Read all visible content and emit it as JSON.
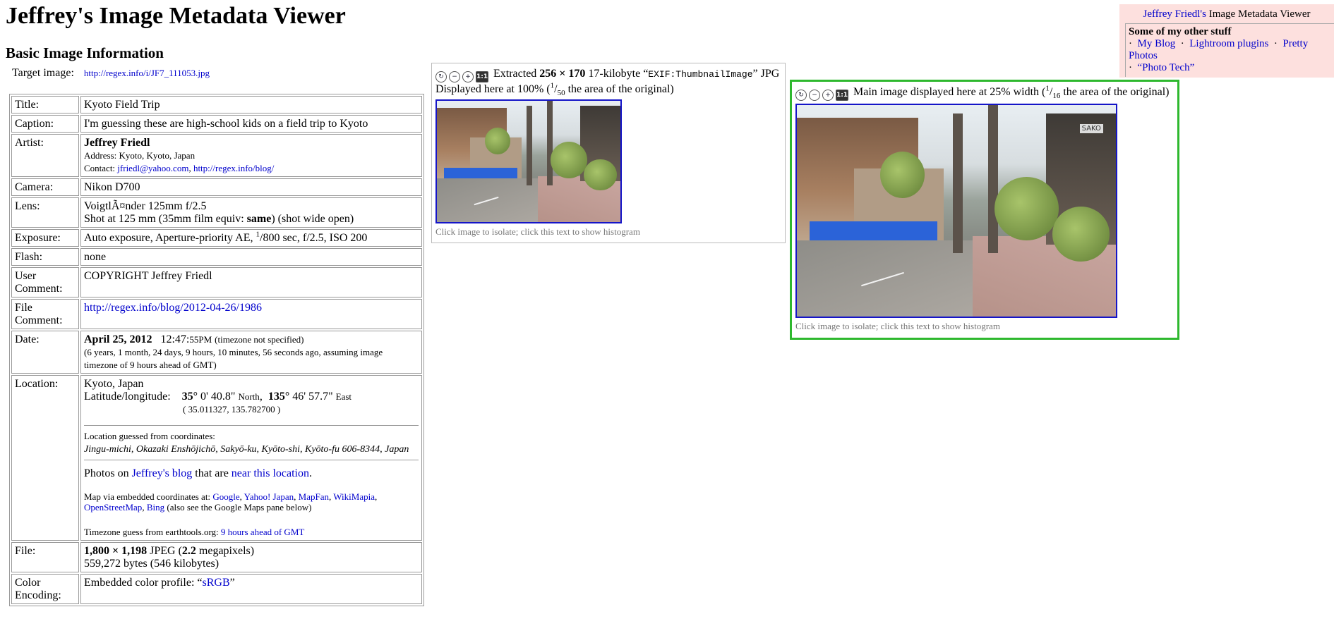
{
  "page": {
    "title": "Jeffrey's Image Metadata Viewer",
    "section": "Basic Image Information",
    "target_label": "Target image:",
    "target_url": "http://regex.info/i/JF7_111053.jpg"
  },
  "rows": {
    "title": {
      "label": "Title:",
      "value": "Kyoto Field Trip"
    },
    "caption": {
      "label": "Caption:",
      "value": "I'm guessing these are high-school kids on a field trip to Kyoto"
    },
    "artist": {
      "label": "Artist:",
      "name": "Jeffrey Friedl",
      "address": "Address: Kyoto, Kyoto, Japan",
      "contact_label": "Contact:",
      "email": "jfriedl@yahoo.com",
      "sep": ",",
      "url": "http://regex.info/blog/"
    },
    "camera": {
      "label": "Camera:",
      "value": "Nikon D700"
    },
    "lens": {
      "label": "Lens:",
      "value": "VoigtlÃ¤nder 125mm f/2.5",
      "shot_a": "Shot at 125 mm (35mm film equiv: ",
      "shot_b": "same",
      "shot_c": ") (shot wide open)"
    },
    "exposure": {
      "label": "Exposure:",
      "value_a": "Auto exposure, Aperture-priority AE, ",
      "num": "1",
      "value_b": "/800 sec, f/2.5, ISO 200"
    },
    "flash": {
      "label": "Flash:",
      "value": "none"
    },
    "user_comment": {
      "label": "User Comment:",
      "value": "COPYRIGHT Jeffrey Friedl"
    },
    "file_comment": {
      "label": "File Comment:",
      "value": "http://regex.info/blog/2012-04-26/1986"
    },
    "date": {
      "label": "Date:",
      "date": "April 25, 2012",
      "time": "12:47:",
      "time_small": "55PM",
      "tz": "(timezone not specified)",
      "ago": "(6 years, 1 month, 24 days, 9 hours, 10 minutes, 56 seconds ago, assuming image timezone of 9 hours ahead of GMT)"
    },
    "location": {
      "label": "Location:",
      "place": "Kyoto, Japan",
      "latlong_label": "Latitude/longitude:",
      "lat_deg": "35°",
      "lat_rest": " 0' 40.8\"",
      "lat_dir": "North",
      "lon_deg": "135°",
      "lon_rest": " 46' 57.7\"",
      "lon_dir": "East",
      "decimal": "( 35.011327, 135.782700 )",
      "guess_label": "Location guessed from coordinates:",
      "guess": "Jingu-michi, Okazaki Enshōjichō, Sakyō-ku, Kyōto-shi, Kyōto-fu 606-8344, Japan",
      "photos_a": "Photos on ",
      "photos_link1": "Jeffrey's blog",
      "photos_b": " that are ",
      "photos_link2": "near this location",
      "photos_c": ".",
      "map_label": "Map via embedded coordinates at: ",
      "maps": [
        "Google",
        "Yahoo! Japan",
        "MapFan",
        "WikiMapia",
        "OpenStreetMap",
        "Bing"
      ],
      "map_tail": " (also see the Google Maps pane below)",
      "tz_label": "Timezone guess from earthtools.org: ",
      "tz_link": "9 hours ahead of GMT"
    },
    "file": {
      "label": "File:",
      "dims": "1,800 × 1,198",
      "fmt": " JPEG (",
      "mp": "2.2",
      "mp_tail": " megapixels)",
      "bytes": "559,272 bytes (546 kilobytes)"
    },
    "color": {
      "label": "Color Encoding:",
      "value_a": "Embedded color profile: “",
      "link": "sRGB",
      "value_b": "”"
    }
  },
  "thumb": {
    "text_a": "Extracted ",
    "size": "256 × 170",
    "text_b": " 17-kilobyte “",
    "tag": "EXIF:ThumbnailImage",
    "text_c": "” JPG",
    "line2_a": "Displayed here at 100% (",
    "frac_n": "1",
    "frac_d": "50",
    "line2_b": " the area of the original)",
    "caption": "Click image to isolate; click this text to show histogram"
  },
  "main": {
    "text_a": "Main image displayed here at 25% width (",
    "frac_n": "1",
    "frac_d": "16",
    "text_b": " the area of the original)",
    "caption": "Click image to isolate; click this text to show histogram",
    "sign": "SAKO"
  },
  "sidebar": {
    "author_link": "Jeffrey Friedl's",
    "title_rest": " Image Metadata Viewer",
    "heading": "Some of my other stuff",
    "bullet": "·",
    "links": [
      "My Blog",
      "Lightroom plugins",
      "Pretty Photos",
      "“Photo Tech”"
    ]
  },
  "icons": {
    "rotate": "rotate-icon",
    "zoom_out": "zoom-out-icon",
    "zoom_in": "zoom-in-icon",
    "actual": "actual-size-icon",
    "actual_label": "1:1"
  },
  "colors": {
    "link": "#0000cc",
    "frame": "#2eb82e",
    "sidebar_bg": "#fde0de",
    "image_border": "#1515c8"
  }
}
